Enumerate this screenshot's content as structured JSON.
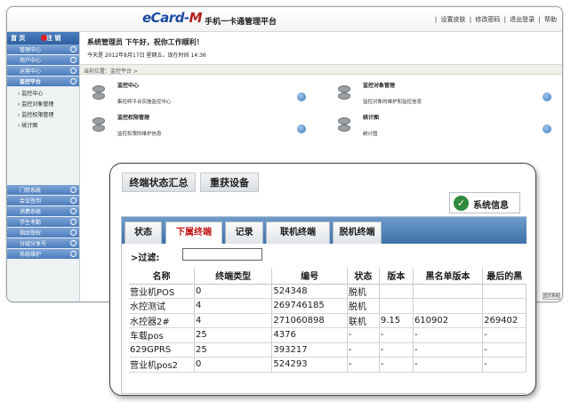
{
  "app": {
    "brand_main": "eCard-",
    "brand_accent": "M",
    "subtitle": "手机一卡通管理平台",
    "toplinks": [
      "|",
      "设置皮肤",
      "|",
      "修改密码",
      "|",
      "退出登录",
      "|",
      "帮助"
    ]
  },
  "sidebar": {
    "top_left": "首 页",
    "top_right": "注 销",
    "items": [
      "管理中心",
      "用户中心",
      "运营中心"
    ],
    "selected": "监控平台",
    "subitems": [
      "监控中心",
      "监控对象管理",
      "监控权限管理",
      "统计图"
    ],
    "bottom_items": [
      "门禁系统",
      "会议签到",
      "消费系统",
      "学生考勤",
      "指纹授权",
      "分组分享号",
      "系统维护"
    ]
  },
  "main": {
    "welcome": "系统管理员 下午好，祝你工作顺利！",
    "date": "今天是 2012年8月17日 星期五，现在时间 14:36",
    "breadcrumb": "当前位置：监控平台 >",
    "cards": [
      {
        "title": "监控中心",
        "desc": "集控终平台实施监控中心"
      },
      {
        "title": "监控对象管理",
        "desc": "监控对象的维护和监控信息"
      },
      {
        "title": "监控权限管理",
        "desc": "监控权限的维护信息"
      },
      {
        "title": "统计图",
        "desc": "统计图"
      }
    ],
    "status_button": "显示系统"
  },
  "popup": {
    "tabs": [
      "终端状态汇总",
      "重获设备"
    ],
    "sysinfo": "系统信息",
    "sysinfo_icon": "check-circle-icon",
    "inner_tabs": [
      "状态",
      "下属终端",
      "记录",
      "联机终端",
      "脱机终端"
    ],
    "active_inner_tab": 1,
    "filter_label": ">过滤:",
    "filter_value": "",
    "columns": [
      "名称",
      "终端类型",
      "编号",
      "状态",
      "版本",
      "黑名单版本",
      "最后的黑"
    ],
    "rows": [
      [
        "营业机POS",
        "0",
        "524348",
        "脱机",
        "",
        "",
        ""
      ],
      [
        "水控测试",
        "4",
        "269746185",
        "脱机",
        "",
        "",
        ""
      ],
      [
        "水控器2#",
        "4",
        "271060898",
        "联机",
        "9.15",
        "610902",
        "269402"
      ],
      [
        "车载pos",
        "25",
        "4376",
        "-",
        "-",
        "-",
        "-"
      ],
      [
        "629GPRS",
        "25",
        "393217",
        "-",
        "-",
        "-",
        "-"
      ],
      [
        "营业机pos2",
        "0",
        "524293",
        "-",
        "-",
        "-",
        "-"
      ]
    ],
    "colors": {
      "active_tab": "#c11616",
      "bar": "#3f71a8",
      "check": "#2f8a3d"
    }
  }
}
